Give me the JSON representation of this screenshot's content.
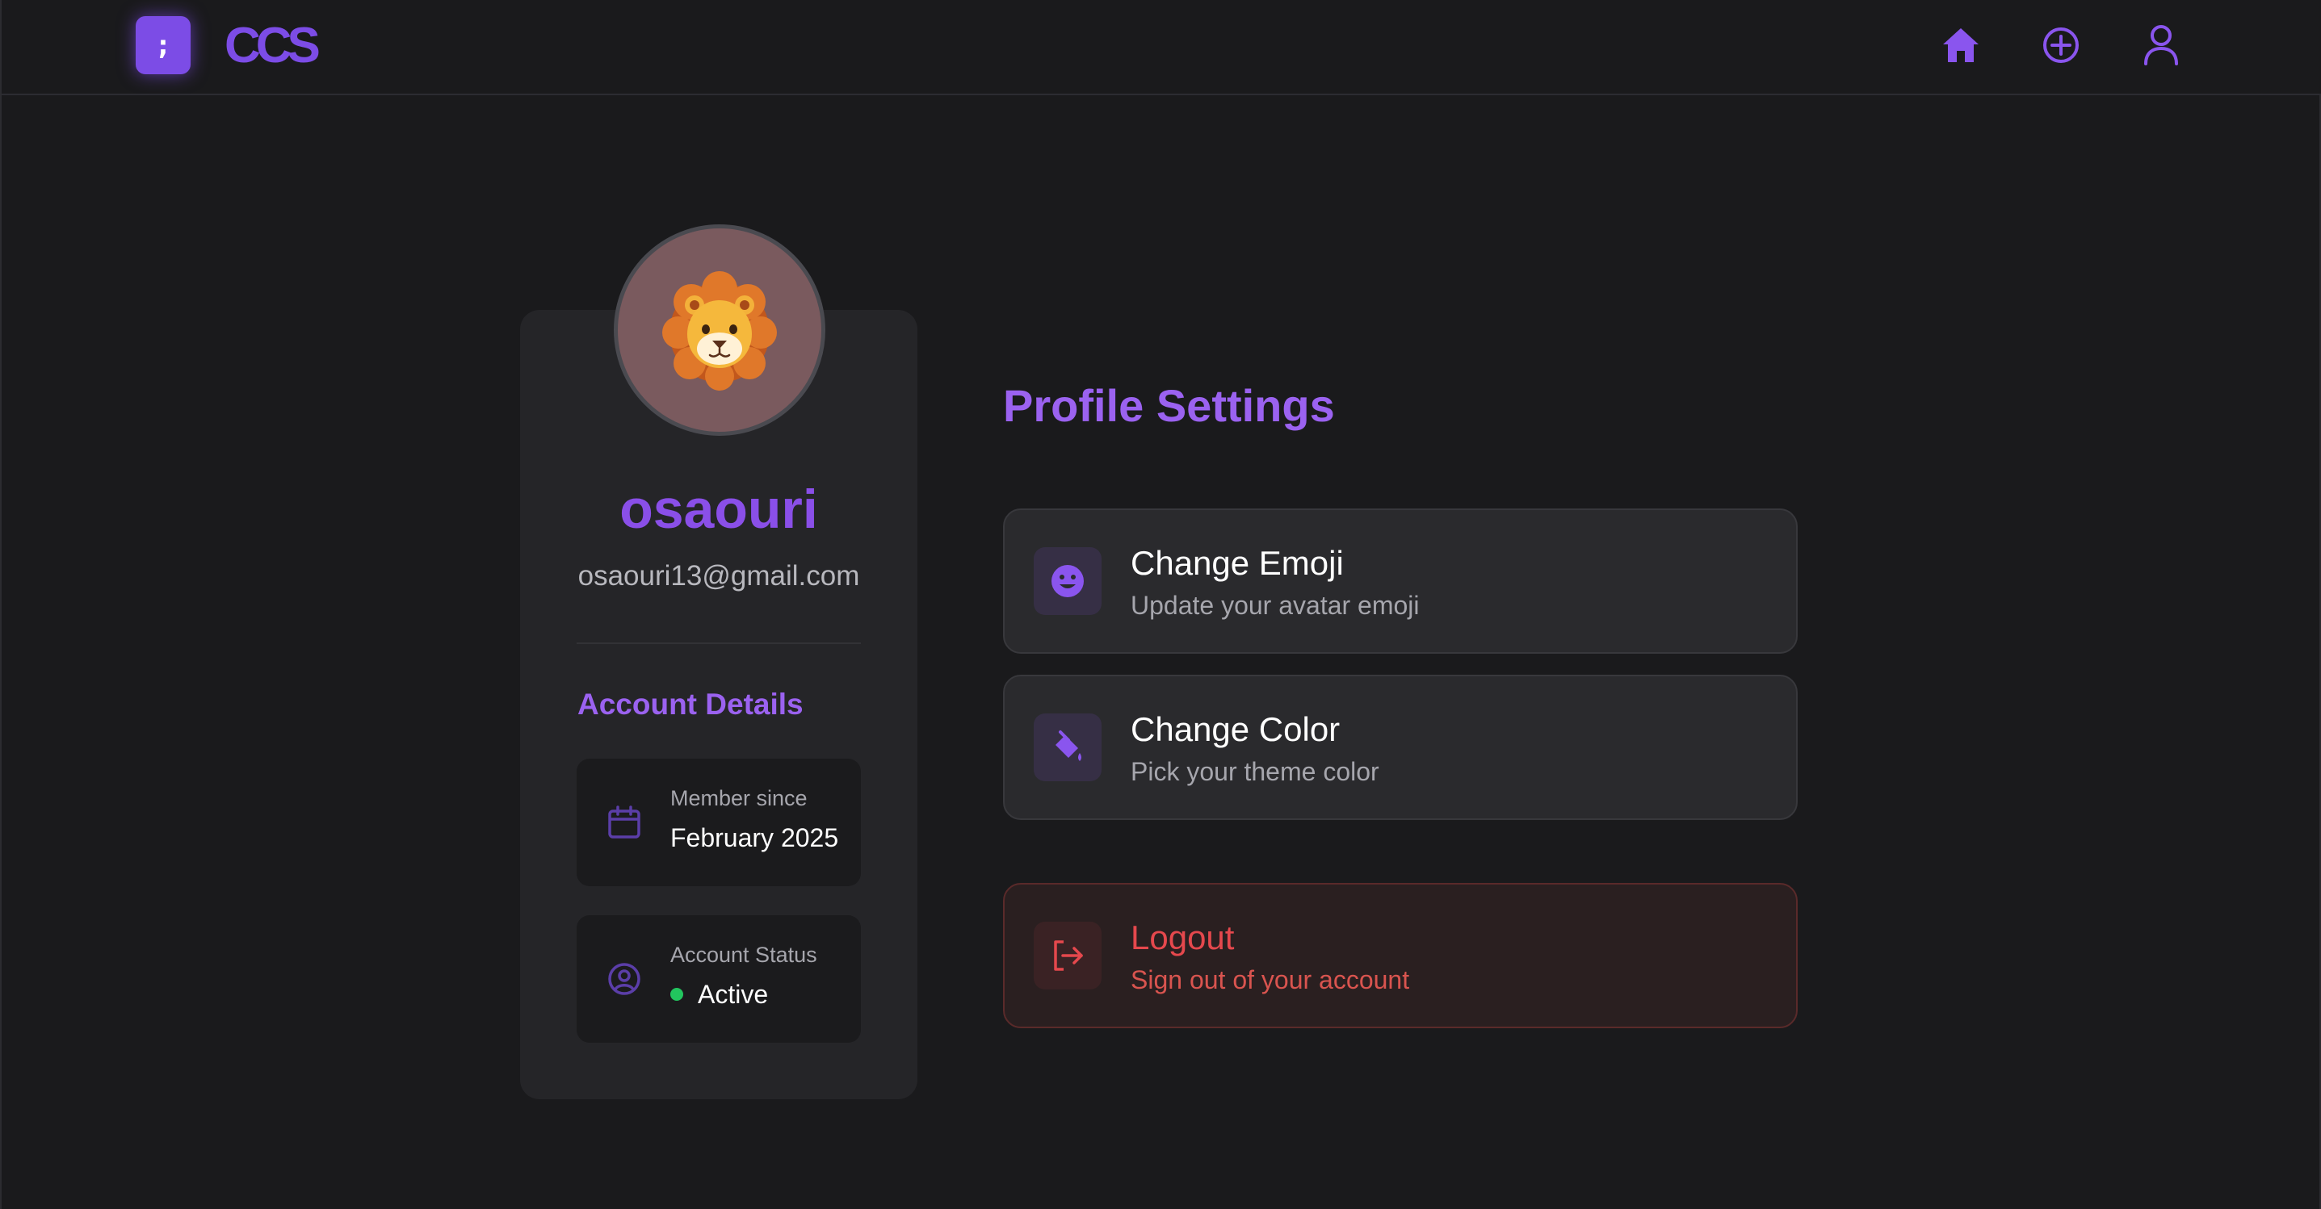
{
  "header": {
    "logo_symbol": ";",
    "logo_text": "CCS",
    "nav": [
      {
        "name": "home",
        "icon": "home-icon"
      },
      {
        "name": "create",
        "icon": "plus-circle-icon"
      },
      {
        "name": "profile",
        "icon": "user-icon"
      }
    ]
  },
  "profile": {
    "avatar_emoji_icon": "lion-face-icon",
    "username": "osaouri",
    "email": "osaouri13@gmail.com",
    "details_title": "Account Details",
    "member_since_label": "Member since",
    "member_since_value": "February 2025",
    "status_label": "Account Status",
    "status_value": "Active"
  },
  "settings": {
    "title": "Profile Settings",
    "change_emoji_title": "Change Emoji",
    "change_emoji_sub": "Update your avatar emoji",
    "change_color_title": "Change Color",
    "change_color_sub": "Pick your theme color",
    "logout_title": "Logout",
    "logout_sub": "Sign out of your account"
  },
  "colors": {
    "accent": "#7c4ce6",
    "accent_text": "#9b62f0",
    "danger": "#e5484d",
    "status_active": "#22c55e",
    "background": "#1a1a1c",
    "card": "#252528"
  }
}
